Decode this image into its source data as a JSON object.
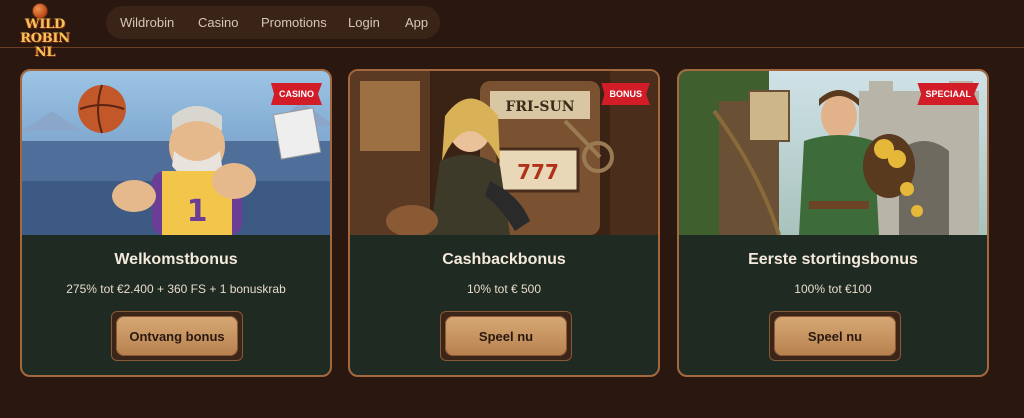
{
  "header": {
    "logo_line1": "WILD ROBIN",
    "logo_line2": "NL",
    "nav": [
      "Wildrobin",
      "Casino",
      "Promotions",
      "Login",
      "App"
    ]
  },
  "cards": [
    {
      "ribbon": "CASINO",
      "title": "Welkomstbonus",
      "description": "275% tot €2.400 + 360 FS + 1 bonuskrab",
      "button": "Ontvang bonus"
    },
    {
      "ribbon": "BONUS",
      "title": "Cashbackbonus",
      "description": "10% tot € 500",
      "button": "Speel nu"
    },
    {
      "ribbon": "SPECIAAL",
      "title": "Eerste stortingsbonus",
      "description": "100% tot €100",
      "button": "Speel nu"
    }
  ]
}
